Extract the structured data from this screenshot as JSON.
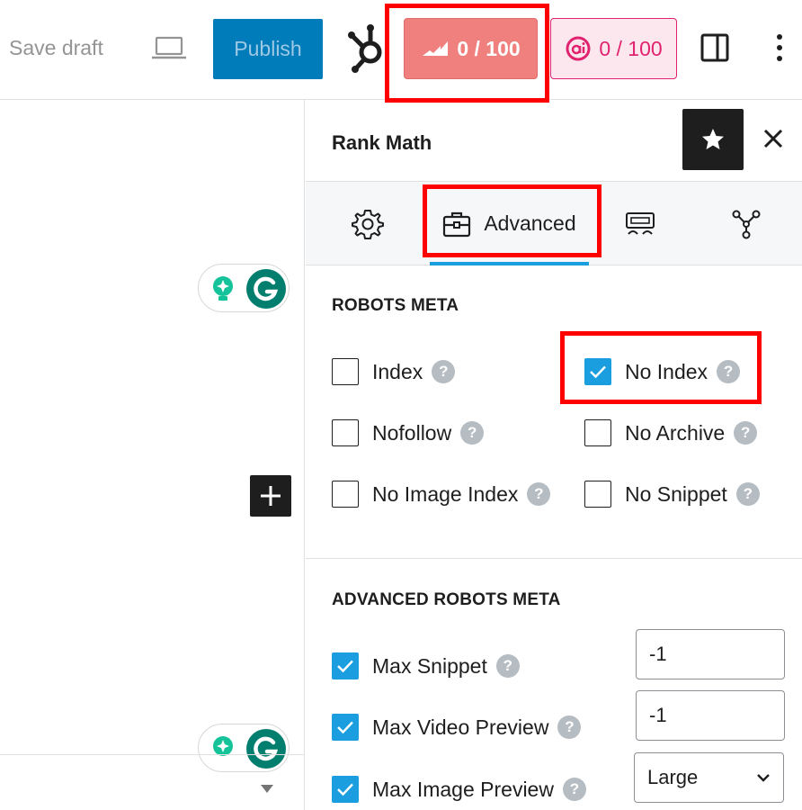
{
  "toolbar": {
    "save_draft_label": "Save draft",
    "publish_label": "Publish",
    "rank_math_score": "0 / 100",
    "content_ai_score": "0 / 100"
  },
  "sidebar": {
    "title": "Rank Math",
    "tabs": [
      {
        "name": "general",
        "icon": "gear-icon",
        "label": ""
      },
      {
        "name": "advanced",
        "icon": "briefcase-icon",
        "label": "Advanced"
      },
      {
        "name": "schema",
        "icon": "schema-icon",
        "label": ""
      },
      {
        "name": "social",
        "icon": "social-nodes-icon",
        "label": ""
      }
    ],
    "active_tab": "advanced"
  },
  "robots_meta": {
    "title": "ROBOTS META",
    "options": [
      {
        "label": "Index",
        "checked": false
      },
      {
        "label": "No Index",
        "checked": true
      },
      {
        "label": "Nofollow",
        "checked": false
      },
      {
        "label": "No Archive",
        "checked": false
      },
      {
        "label": "No Image Index",
        "checked": false
      },
      {
        "label": "No Snippet",
        "checked": false
      }
    ]
  },
  "advanced_robots_meta": {
    "title": "ADVANCED ROBOTS META",
    "rows": [
      {
        "label": "Max Snippet",
        "checked": true,
        "value": "-1"
      },
      {
        "label": "Max Video Preview",
        "checked": true,
        "value": "-1"
      },
      {
        "label": "Max Image Preview",
        "checked": true,
        "value": "Large"
      }
    ]
  },
  "help_glyph": "?",
  "colors": {
    "accent_blue": "#1a9ee0",
    "publish_blue": "#007cba",
    "rank_math_red": "#f0807d",
    "content_ai_pink": "#e1226e",
    "highlight_red": "#ff0000"
  }
}
